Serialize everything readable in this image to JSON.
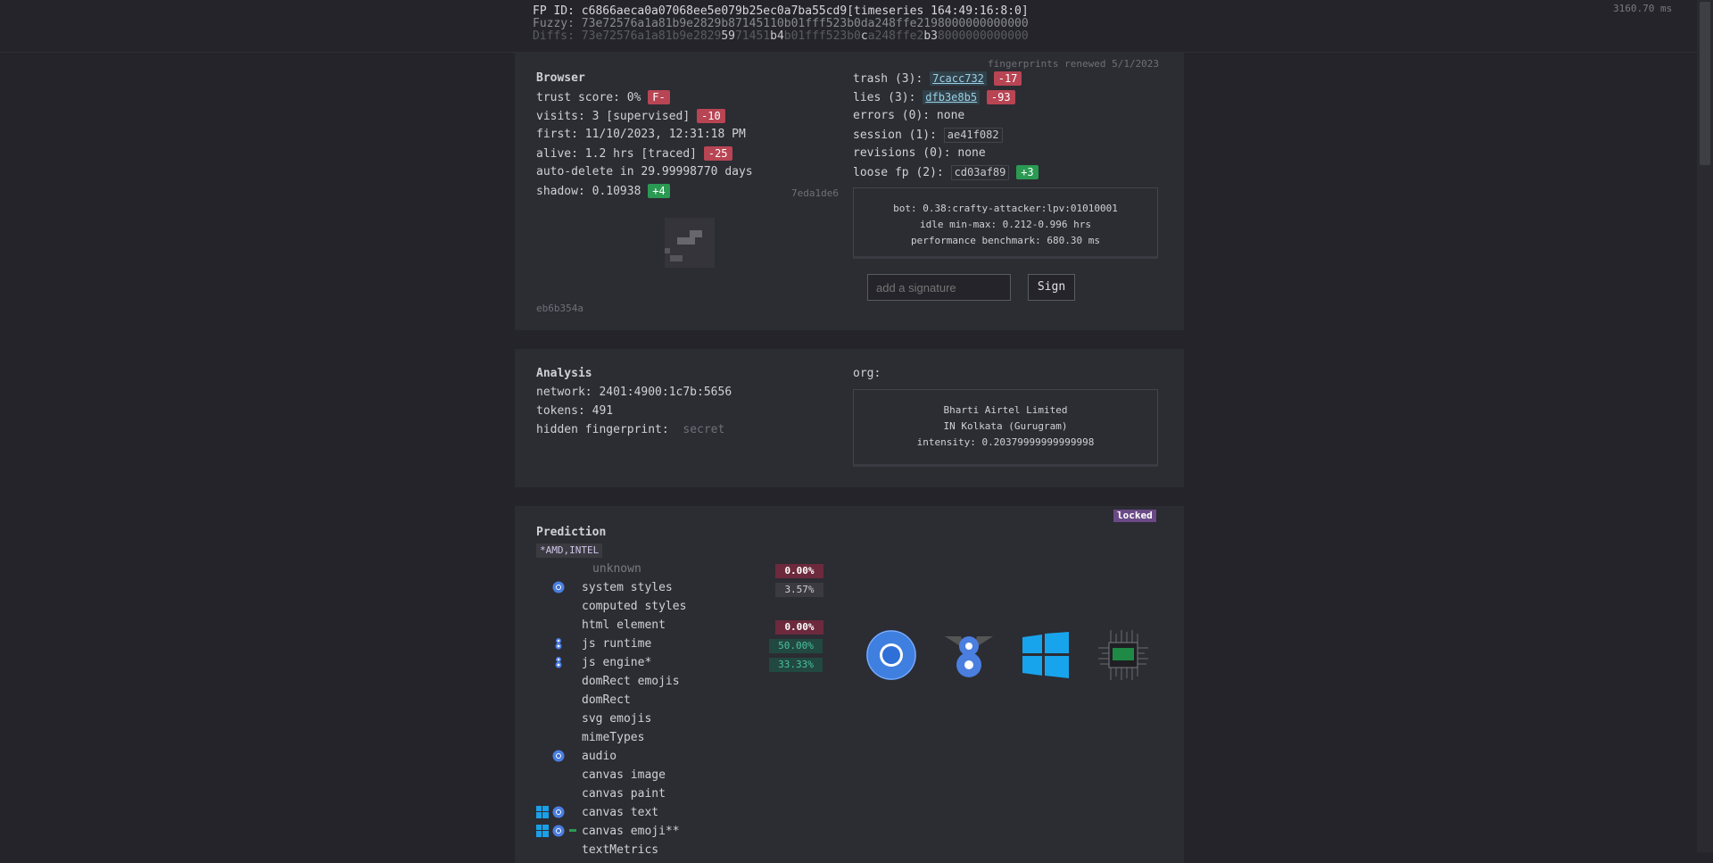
{
  "header": {
    "fp_id": "FP ID: c6866aeca0a07068ee5e079b25ec0a7ba55cd9[timeseries 164:49:16:8:0]",
    "fuzzy": "Fuzzy: 73e72576a1a81b9e2829b87145110b01fff523b0da248ffe2198000000000000",
    "diffs_prefix": "Diffs: 73e72576a1a81b9e2829",
    "diffs_a": "59",
    "diffs_b": "71451",
    "diffs_c": "b4",
    "diffs_d": "b01fff523b0",
    "diffs_e": "c",
    "diffs_f": "a248ffe2",
    "diffs_g": "b3",
    "diffs_h": "8000000000000",
    "timer": "3160.70 ms"
  },
  "browser": {
    "renewed": "fingerprints renewed 5/1/2023",
    "title": "Browser",
    "trust_label": "trust score: 0%",
    "trust_badge": "F-",
    "visits_label": "visits: 3 [supervised]",
    "visits_badge": "-10",
    "first": "first: 11/10/2023, 12:31:18 PM",
    "alive_label": "alive: 1.2 hrs [traced]",
    "alive_badge": "-25",
    "autodelete": "auto-delete in 29.99998770 days",
    "shadow_label": "shadow: 0.10938",
    "shadow_badge": "+4",
    "shadow_hash": "7eda1de6",
    "image_hash": "eb6b354a",
    "trash_label": "trash (3):",
    "trash_hash": "7cacc732",
    "trash_badge": "-17",
    "lies_label": "lies (3):",
    "lies_hash": "dfb3e8b5",
    "lies_badge": "-93",
    "errors": "errors (0): none",
    "session_label": "session (1):",
    "session_hash": "ae41f082",
    "revisions": "revisions (0): none",
    "loose_label": "loose fp (2):",
    "loose_hash": "cd03af89",
    "loose_badge": "+3",
    "bot_line1": "bot: 0.38:crafty-attacker:lpv:01010001",
    "bot_line2": "idle min-max: 0.212-0.996 hrs",
    "bot_line3": "performance benchmark: 680.30 ms",
    "signature_placeholder": "add a signature",
    "sign_label": "Sign"
  },
  "analysis": {
    "title": "Analysis",
    "network": "network: 2401:4900:1c7b:5656",
    "tokens": "tokens: 491",
    "hidden_label": "hidden fingerprint:",
    "hidden_value": "secret",
    "org_label": "org:",
    "org_line1": "Bharti Airtel Limited",
    "org_line2": "IN Kolkata (Gurugram)",
    "org_line3": "intensity: 0.20379999999999998"
  },
  "prediction": {
    "title": "Prediction",
    "locked": "locked",
    "tag": "*AMD,INTEL",
    "rows": [
      {
        "label": "unknown",
        "pct": "0.00%"
      },
      {
        "label": "system styles",
        "pct": "3.57%"
      },
      {
        "label": "computed styles",
        "pct": ""
      },
      {
        "label": "html element",
        "pct": "0.00%"
      },
      {
        "label": "js runtime",
        "pct": "50.00%"
      },
      {
        "label": "js engine*",
        "pct": "33.33%"
      },
      {
        "label": "domRect emojis",
        "pct": ""
      },
      {
        "label": "domRect",
        "pct": ""
      },
      {
        "label": "svg emojis",
        "pct": ""
      },
      {
        "label": "mimeTypes",
        "pct": ""
      },
      {
        "label": "audio",
        "pct": ""
      },
      {
        "label": "canvas image",
        "pct": ""
      },
      {
        "label": "canvas paint",
        "pct": ""
      },
      {
        "label": "canvas text",
        "pct": ""
      },
      {
        "label": "canvas emoji**",
        "pct": ""
      },
      {
        "label": "textMetrics",
        "pct": ""
      }
    ],
    "icons": [
      "chrome-icon",
      "v8-icon",
      "windows-icon",
      "cpu-chip-icon"
    ],
    "colors": {
      "bad": "#b84553",
      "good": "#2a9a53",
      "locked": "#6a4a86"
    }
  }
}
